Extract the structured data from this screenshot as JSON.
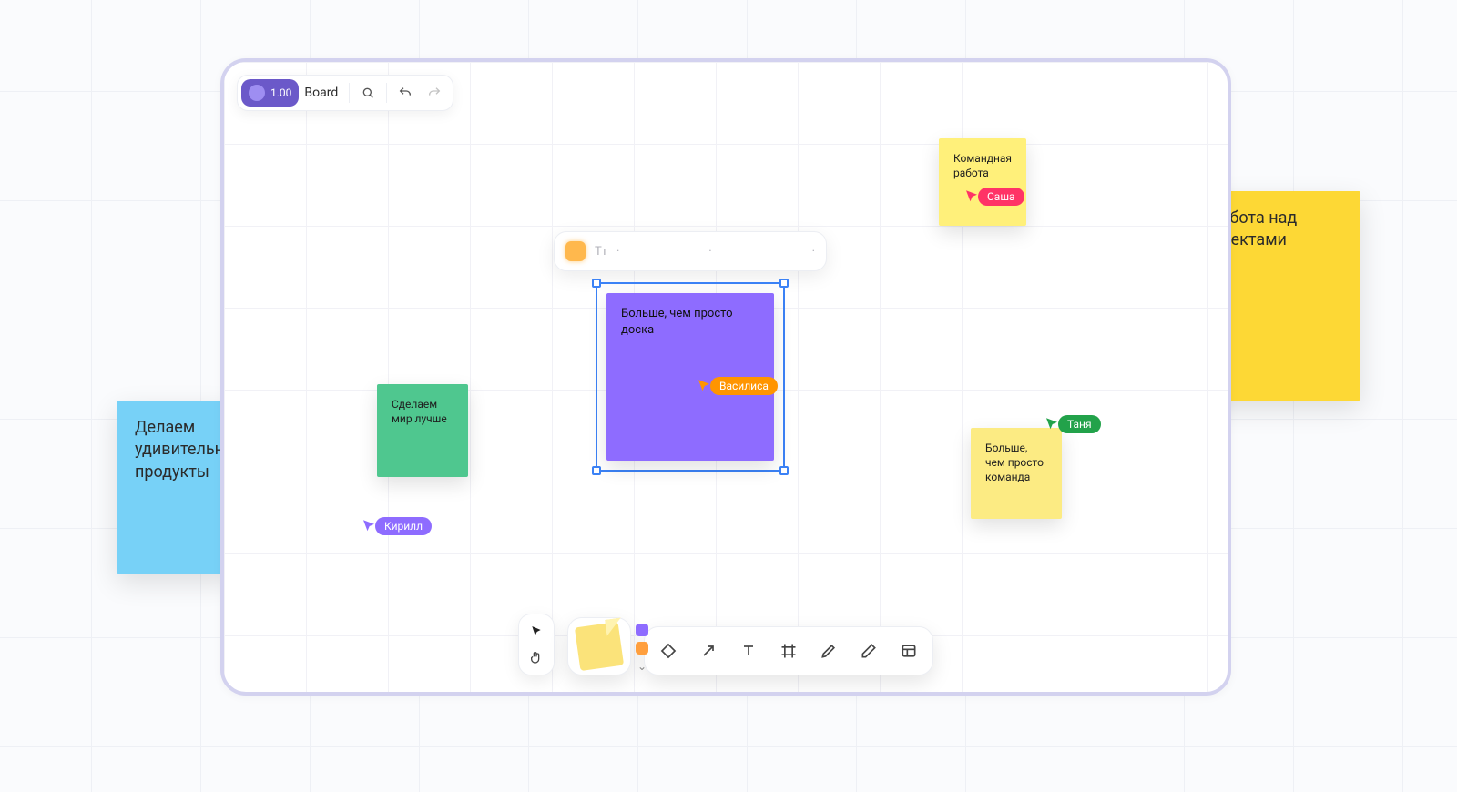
{
  "topbar": {
    "zoom": "1.00",
    "board_name": "Board"
  },
  "context_toolbar": {
    "typography": "Tт",
    "dot1": "·",
    "dot2": "·",
    "dot3": "·"
  },
  "notes": {
    "purple": "Больше, чем просто доска",
    "green": "Сделаем мир лучше",
    "yellow_top": "Командная работа",
    "yellow_bottom": "Больше, чем просто команда"
  },
  "external": {
    "blue": "Делаем удивительные продукты",
    "yellow": "Командная работа над будущими проектами"
  },
  "cursors": {
    "vasilisa": "Василиса",
    "kirill": "Кирилл",
    "sasha": "Саша",
    "tanya": "Таня"
  },
  "colors": {
    "vasilisa": "#ff9500",
    "kirill": "#8e6cff",
    "sasha": "#ff3366",
    "tanya": "#22a24a"
  }
}
